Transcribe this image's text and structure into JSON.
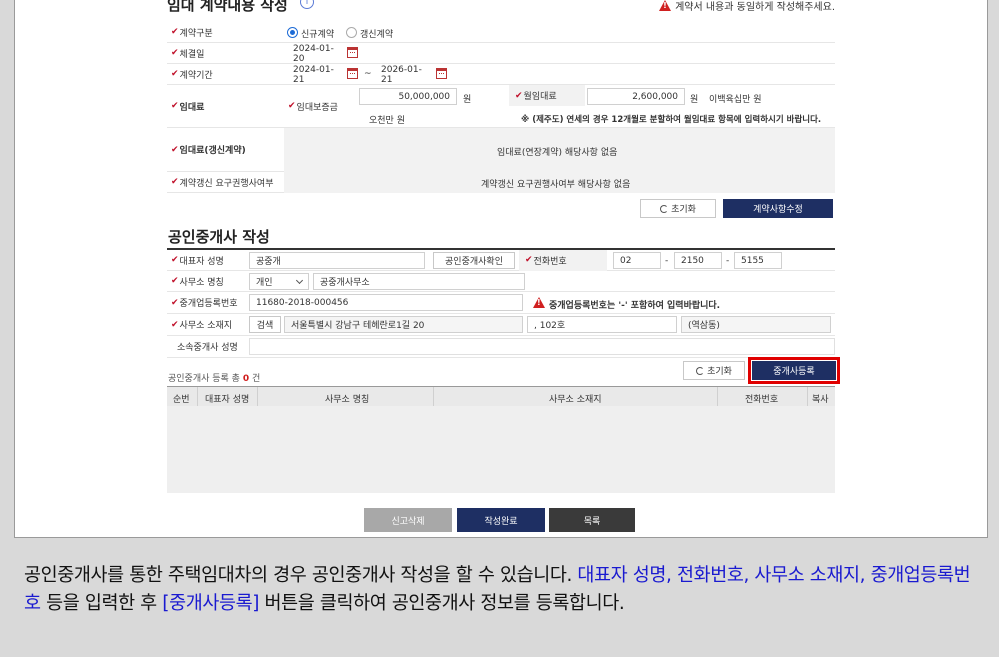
{
  "header": {
    "title": "임대 계약내용 작성",
    "notice": "계약서 내용과 동일하게 작성해주세요."
  },
  "contract": {
    "type_label": "계약구분",
    "type_options": [
      "신규계약",
      "갱신계약"
    ],
    "sign_date_label": "체결일",
    "sign_date": "2024-01-20",
    "period_label": "계약기간",
    "period_start": "2024-01-21",
    "period_sep": "~",
    "period_end": "2026-01-21",
    "rent_label": "임대료",
    "deposit_label": "임대보증금",
    "deposit_value": "50,000,000",
    "deposit_unit": "원",
    "deposit_korean": "오천만 원",
    "monthly_label": "월임대료",
    "monthly_value": "2,600,000",
    "monthly_unit": "원",
    "monthly_korean": "이백육십만 원",
    "monthly_note": "※ (제주도) 연세의 경우 12개월로 분할하여 월임대료 항목에 입력하시기 바랍니다.",
    "renew_rent_label": "임대료(갱신계약)",
    "renew_rent_value": "임대료(연장계약) 해당사항 없음",
    "renew_right_label": "계약갱신 요구권행사여부",
    "renew_right_value": "계약갱신 요구권행사여부 해당사항 없음",
    "reset_button": "초기화",
    "edit_button": "계약사항수정"
  },
  "broker": {
    "section_title": "공인중개사 작성",
    "rep_name_label": "대표자 성명",
    "rep_name_value": "공중개",
    "verify_button": "공인중개사확인",
    "phone_label": "전화번호",
    "phone": [
      "02",
      "2150",
      "5155"
    ],
    "phone_sep": "-",
    "office_name_label": "사무소 명칭",
    "office_type": "개인",
    "office_name_value": "공중개사무소",
    "reg_no_label": "중개업등록번호",
    "reg_no_value": "11680-2018-000456",
    "reg_no_notice": "중개업등록번호는 '-' 포함하여 입력바랍니다.",
    "address_label": "사무소 소재지",
    "search_button": "검색",
    "address_value": "서울특별시 강남구 테헤란로1길 20",
    "address_detail": ", 102호",
    "address_extra": "(역삼동)",
    "affiliated_label": "소속중개사 성명",
    "count_prefix": "공인중개사 등록 총",
    "count_value": "0",
    "count_suffix": "건",
    "reset_button": "초기화",
    "register_button": "중개사등록",
    "table_headers": [
      "순번",
      "대표자 성명",
      "사무소 명칭",
      "사무소 소재지",
      "전화번호",
      "복사"
    ]
  },
  "footer_buttons": {
    "delete": "신고삭제",
    "complete": "작성완료",
    "list": "목록"
  },
  "caption": {
    "part1": "공인중개사를 통한 주택임대차의 경우 공인중개사 작성을 할 수 있습니다. ",
    "part2": "대표자 성명, 전화번호, 사무소 소재지, 중개업등록번호",
    "part3": " 등을 입력한 후 ",
    "part4": "[중개사등록]",
    "part5": " 버튼을 클릭하여 공인중개사 정보를 등록합니다."
  }
}
